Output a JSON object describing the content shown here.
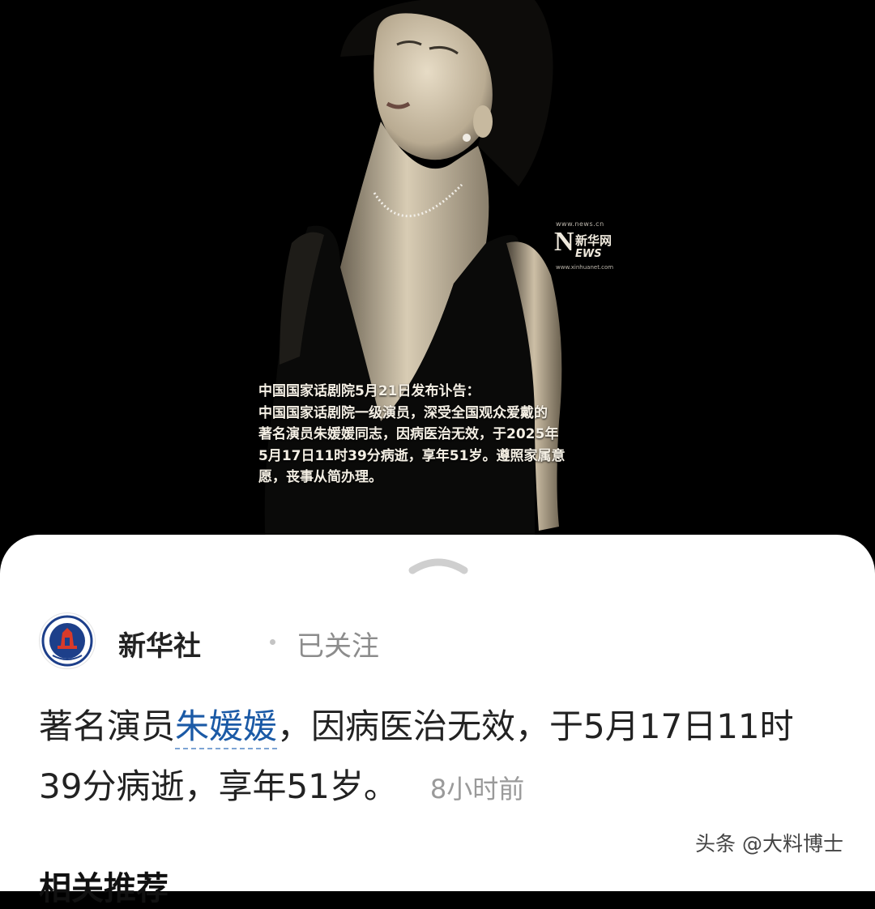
{
  "hero": {
    "watermark": {
      "url_top": "www.news.cn",
      "n_letter": "N",
      "brand": "新华网",
      "ews": "EWS",
      "url_bottom": "www.xinhuanet.com"
    },
    "notice_lines": [
      "中国国家话剧院5月21日发布讣告：",
      "中国国家话剧院一级演员，深受全国观众爱戴的",
      "著名演员朱媛媛同志，因病医治无效，于2025年",
      "5月17日11时39分病逝，享年51岁。遵照家属意",
      "愿，丧事从简办理。"
    ]
  },
  "account": {
    "avatar_text": "XINHUA",
    "name": "新华社",
    "follow_status": "已关注"
  },
  "headline": {
    "prefix": "著名演员",
    "name": "朱媛媛",
    "rest_line1": "，因病医治无效，于5月17日11时",
    "line2": "39分病逝，享年51岁。",
    "time": "8小时前"
  },
  "credit": "头条 @大料博士",
  "related_title": "相关推荐",
  "icons": {
    "handle": "chevron-up-icon",
    "avatar": "xinhua-logo-icon"
  }
}
